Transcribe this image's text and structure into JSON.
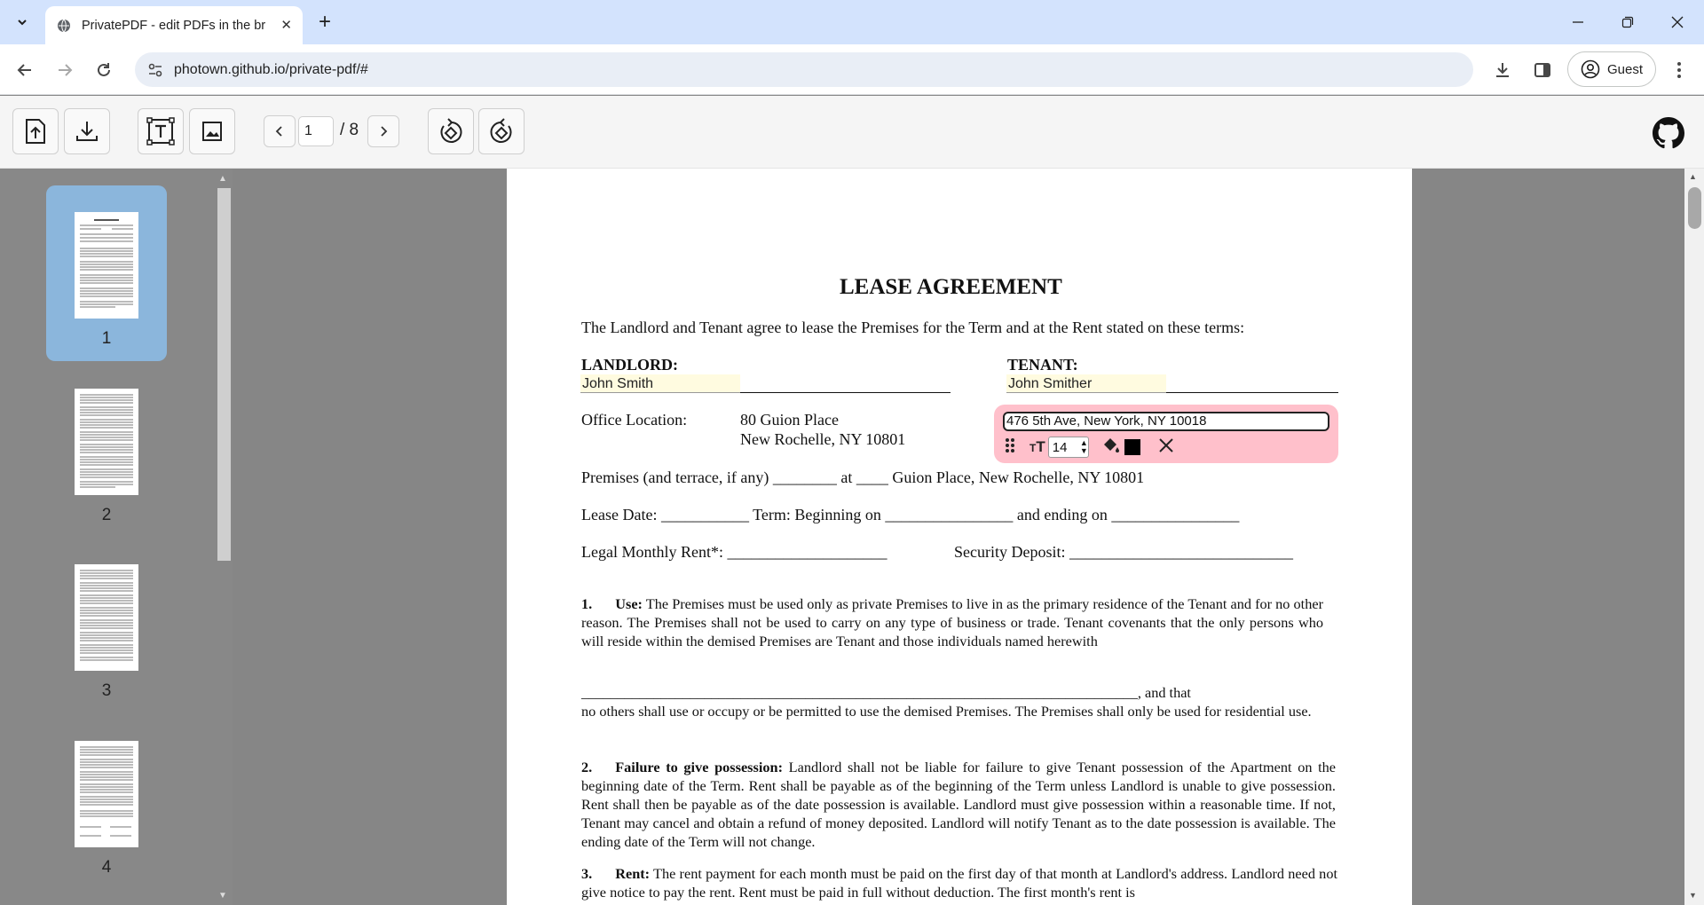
{
  "browser": {
    "tab_title": "PrivatePDF - edit PDFs in the br",
    "url": "photown.github.io/private-pdf/#",
    "profile_label": "Guest"
  },
  "toolbar": {
    "current_page": "1",
    "total_pages": "/ 8"
  },
  "sidebar": {
    "thumbnails": [
      {
        "label": "1",
        "selected": true
      },
      {
        "label": "2",
        "selected": false
      },
      {
        "label": "3",
        "selected": false
      },
      {
        "label": "4",
        "selected": false
      }
    ]
  },
  "document": {
    "title": "LEASE AGREEMENT",
    "intro": "The Landlord and Tenant agree to lease the Premises for the Term and at the Rent stated on these terms:",
    "landlord_label": "LANDLORD:",
    "tenant_label": "TENANT:",
    "landlord_name": "John Smith",
    "tenant_name": "John Smither",
    "office_label": "Office Location:",
    "office_line1": "80 Guion Place",
    "office_line2": "New Rochelle, NY 10801",
    "tenant_address": "476 5th Ave, New York, NY 10018",
    "font_size": "14",
    "premises_line": "Premises (and terrace, if any) ________ at ____ Guion Place, New Rochelle, NY 10801",
    "lease_line": "Lease Date: ___________ Term: Beginning on ________________ and ending on ________________",
    "rent_label": "Legal Monthly Rent*: ____________________",
    "deposit_label": "Security Deposit: ____________________________",
    "s1_num": "1.",
    "s1_title": "Use:",
    "s1_text": "The Premises must be used only as private Premises to live in as the primary residence of the Tenant and for no other reason. The Premises shall not be used to carry on any type of business or trade. Tenant covenants that the only persons who will reside within the demised Premises are Tenant and those individuals named herewith",
    "s1_blank": "_____________________________________________________________________________, and that",
    "s1_text2": "no others shall use or occupy or be permitted to use the demised Premises. The Premises shall only be used for residential use.",
    "s2_num": "2.",
    "s2_title": "Failure to give possession:",
    "s2_text": "Landlord shall not be liable for failure to give Tenant possession of the Apartment on the beginning date of the Term. Rent shall be payable as of the beginning of the Term unless Landlord is unable to give possession. Rent shall then be payable as of the date possession is available. Landlord must give possession within a reasonable time. If not, Tenant may cancel and obtain a refund of money deposited. Landlord will notify Tenant as to the date possession is available. The ending date of the Term will not change.",
    "s3_num": "3.",
    "s3_title": "Rent:",
    "s3_text": "The rent payment for each month must be paid on the first day of that month at Landlord's address. Landlord need not give notice to pay the rent. Rent must be paid in full without deduction. The first month's rent is"
  }
}
